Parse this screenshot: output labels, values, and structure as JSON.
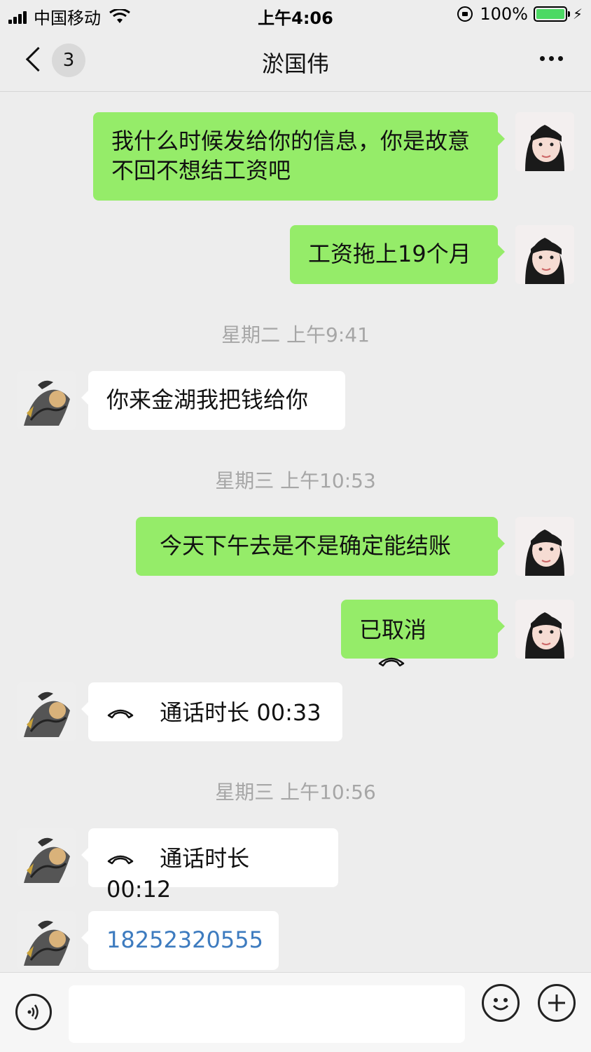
{
  "status_bar": {
    "carrier": "中国移动",
    "time": "上午4:06",
    "battery": "100%"
  },
  "nav": {
    "unread_count": "3",
    "title": "淤国伟"
  },
  "timestamps": [
    "星期二 上午9:41",
    "星期三 上午10:53",
    "星期三 上午10:56"
  ],
  "messages": {
    "m1": "我什么时候发给你的信息，你是故意不回不想结工资吧",
    "m2": "工资拖上19个月",
    "m3": "你来金湖我把钱给你",
    "m4": "今天下午去是不是确定能结账",
    "m5": "已取消",
    "m6": "通话时长 00:33",
    "m7": "通话时长 00:12",
    "m8": "18252320555"
  },
  "input": {
    "placeholder": ""
  },
  "icons": {
    "back": "chevron-left-icon",
    "more": "ellipsis-icon",
    "voice": "voice-icon",
    "emoji": "emoji-icon",
    "plus": "plus-icon",
    "call": "phone-hangup-icon"
  },
  "colors": {
    "sent_bubble": "#95ec69",
    "received_bubble": "#ffffff",
    "background": "#ededed",
    "link": "#3d7bbf"
  }
}
